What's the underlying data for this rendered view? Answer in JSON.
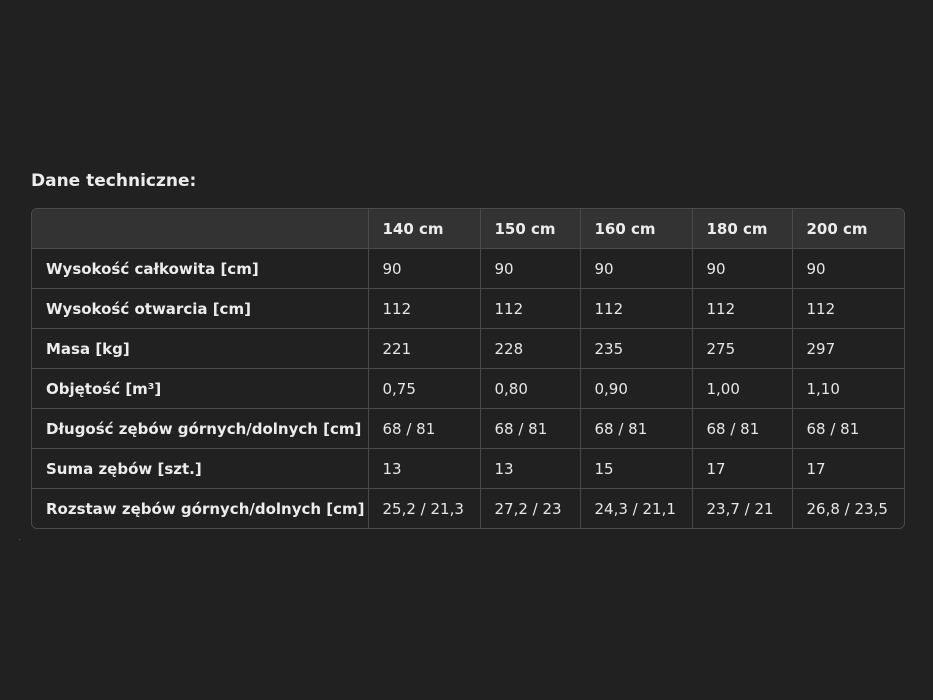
{
  "title": "Dane techniczne:",
  "table": {
    "headers": [
      "",
      "140 cm",
      "150 cm",
      "160 cm",
      "180 cm",
      "200 cm"
    ],
    "rows": [
      {
        "label": "Wysokość całkowita [cm]",
        "values": [
          "90",
          "90",
          "90",
          "90",
          "90"
        ]
      },
      {
        "label": "Wysokość otwarcia [cm]",
        "values": [
          "112",
          "112",
          "112",
          "112",
          "112"
        ]
      },
      {
        "label": "Masa [kg]",
        "values": [
          "221",
          "228",
          "235",
          "275",
          "297"
        ]
      },
      {
        "label": "Objętość [m³]",
        "values": [
          "0,75",
          "0,80",
          "0,90",
          "1,00",
          "1,10"
        ]
      },
      {
        "label": "Długość zębów górnych/dolnych [cm]",
        "values": [
          "68 / 81",
          "68 / 81",
          "68 / 81",
          "68 / 81",
          "68 / 81"
        ]
      },
      {
        "label": "Suma zębów [szt.]",
        "values": [
          "13",
          "13",
          "15",
          "17",
          "17"
        ]
      },
      {
        "label": "Rozstaw zębów górnych/dolnych [cm]",
        "values": [
          "25,2 / 21,3",
          "27,2 / 23",
          "24,3 / 21,1",
          "23,7 / 21",
          "26,8 / 23,5"
        ]
      }
    ]
  }
}
